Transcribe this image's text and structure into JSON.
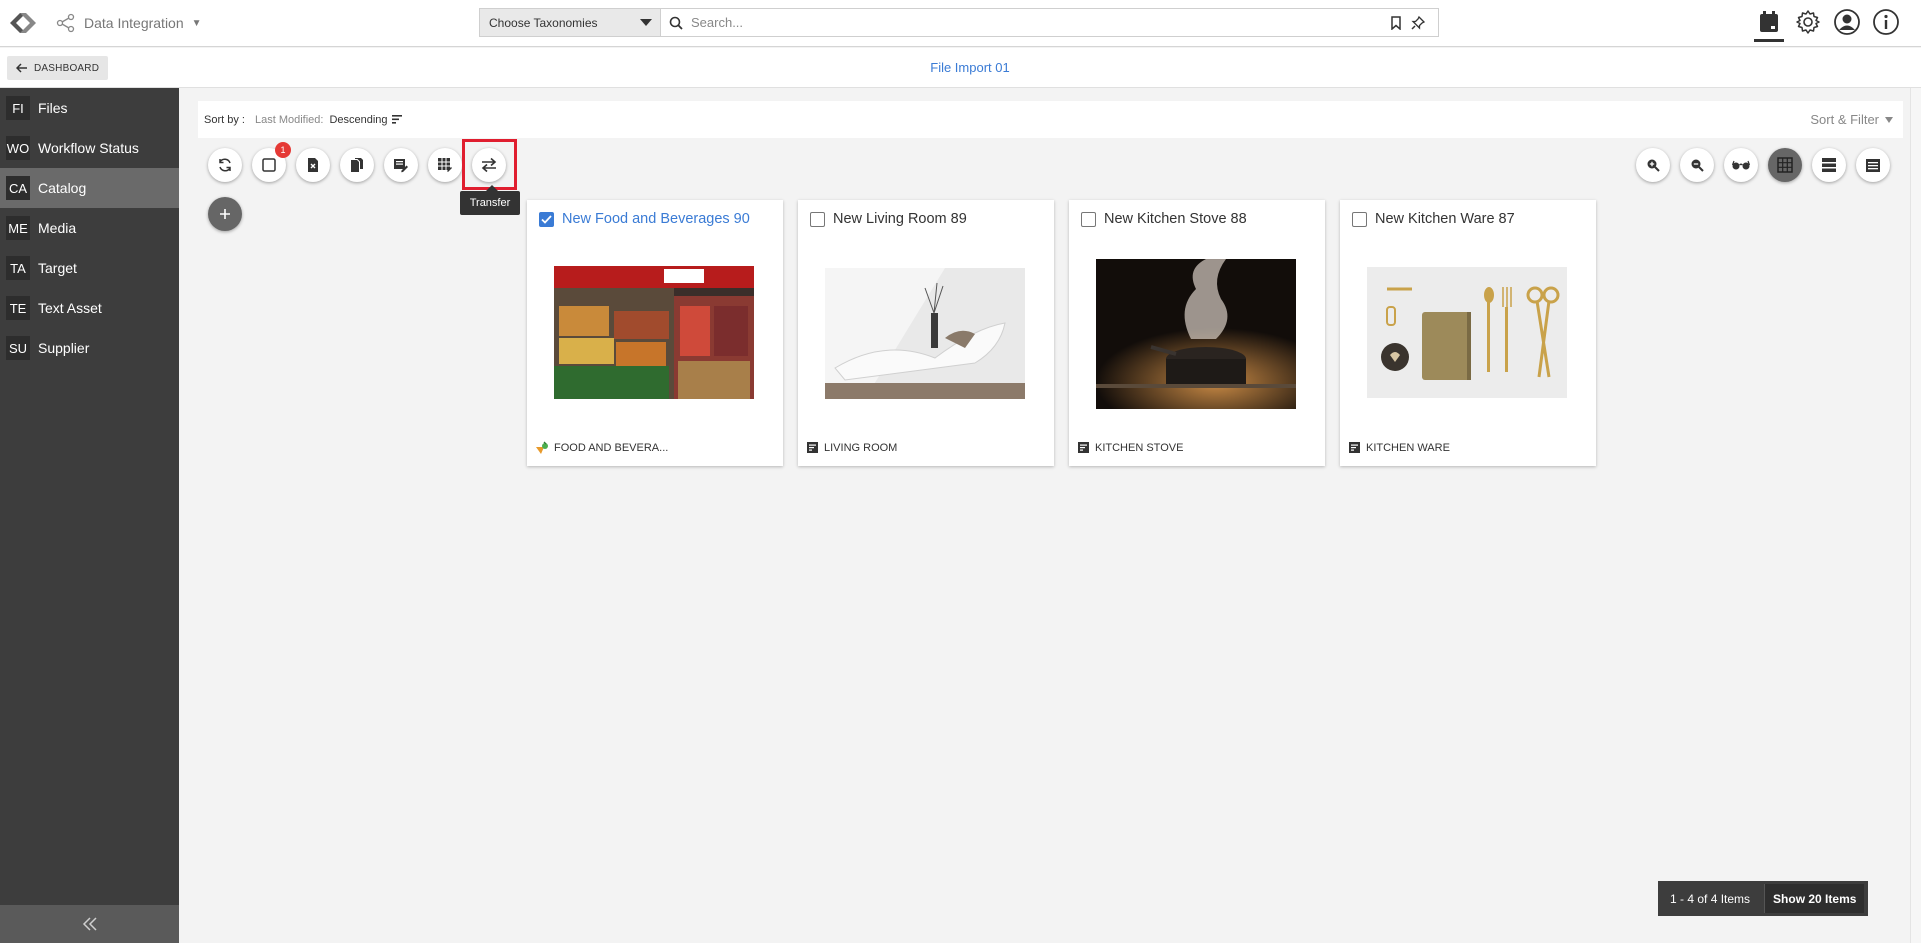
{
  "app": {
    "name": "Data Integration"
  },
  "search": {
    "taxonomy_select": "Choose Taxonomies",
    "placeholder": "Search..."
  },
  "header": {
    "dashboard_label": "DASHBOARD",
    "page_title": "File Import 01"
  },
  "sidebar": {
    "items": [
      {
        "abbr": "FI",
        "label": "Files"
      },
      {
        "abbr": "WO",
        "label": "Workflow Status"
      },
      {
        "abbr": "CA",
        "label": "Catalog"
      },
      {
        "abbr": "ME",
        "label": "Media"
      },
      {
        "abbr": "TA",
        "label": "Target"
      },
      {
        "abbr": "TE",
        "label": "Text Asset"
      },
      {
        "abbr": "SU",
        "label": "Supplier"
      }
    ],
    "active_index": 2
  },
  "sort": {
    "label": "Sort by :",
    "field": "Last Modified:",
    "order": "Descending",
    "filter_label": "Sort & Filter"
  },
  "toolbar": {
    "selected_count": "1",
    "tooltip": "Transfer"
  },
  "cards": [
    {
      "title": "New Food and Beverages 90",
      "category": "FOOD AND BEVERA...",
      "checked": true
    },
    {
      "title": "New Living Room 89",
      "category": "LIVING ROOM",
      "checked": false
    },
    {
      "title": "New Kitchen Stove 88",
      "category": "KITCHEN STOVE",
      "checked": false
    },
    {
      "title": "New Kitchen Ware 87",
      "category": "KITCHEN WARE",
      "checked": false
    }
  ],
  "pagination": {
    "range": "1 - 4 of 4 Items",
    "show_label": "Show 20 Items"
  },
  "colors": {
    "accent": "#3a7bd5",
    "sidebar_bg": "#3d3d3d",
    "highlight": "#e01e2f",
    "badge": "#e53935"
  }
}
